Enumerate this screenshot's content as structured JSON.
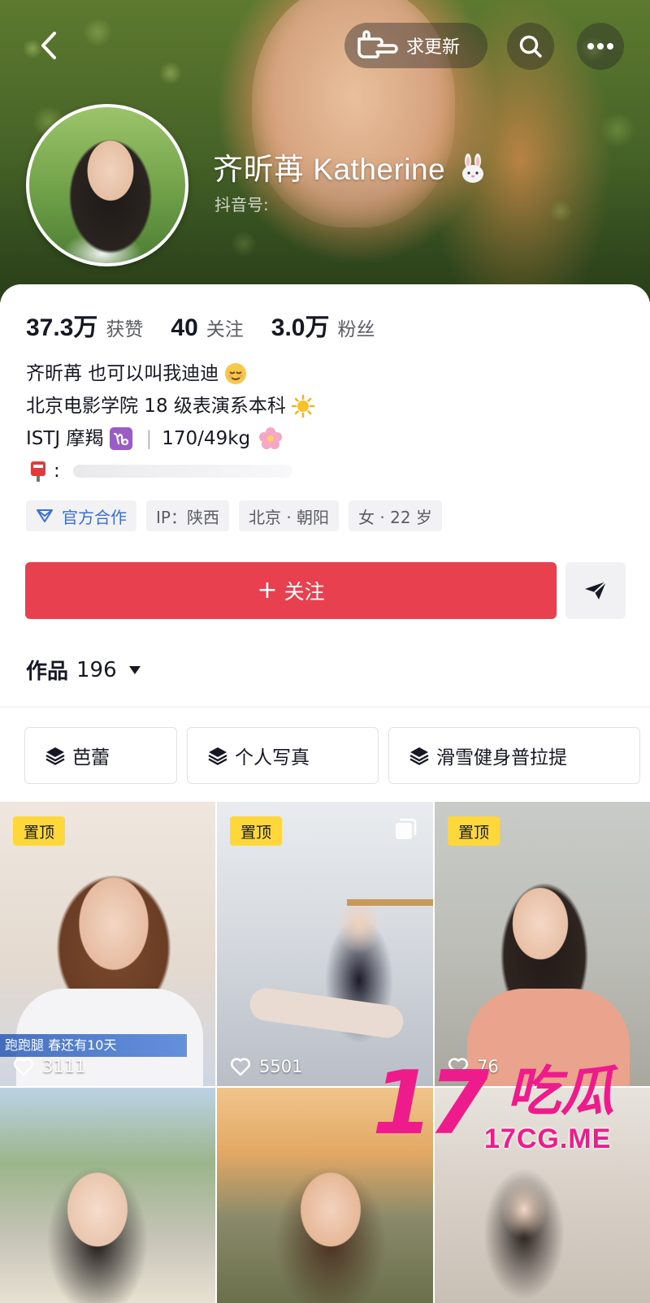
{
  "header": {
    "ask_update_label": "求更新",
    "name": "齐昕苒 Katherine",
    "douyin_id_label": "抖音号:"
  },
  "stats": [
    {
      "value": "37.3万",
      "label": "获赞"
    },
    {
      "value": "40",
      "label": "关注"
    },
    {
      "value": "3.0万",
      "label": "粉丝"
    }
  ],
  "bio": {
    "line1": "齐昕苒 也可以叫我迪迪",
    "line2": "北京电影学院 18 级表演系本科",
    "line3_mbti": "ISTJ 摩羯",
    "line3_sep": "|",
    "line3_body": "170/49kg",
    "line4_prefix": ":"
  },
  "tags": [
    {
      "label": "官方合作"
    },
    {
      "label": "IP：陕西"
    },
    {
      "label": "北京 · 朝阳"
    },
    {
      "label": "女 · 22 岁"
    }
  ],
  "follow_button": {
    "plus": "+",
    "label": "关注"
  },
  "works": {
    "label": "作品",
    "count": "196"
  },
  "collections": [
    {
      "label": "芭蕾"
    },
    {
      "label": "个人写真"
    },
    {
      "label": "滑雪健身普拉提"
    }
  ],
  "videos": [
    {
      "pinned": true,
      "pin_label": "置顶",
      "likes": "3111",
      "overlay_text": "跑跑腿 春还有10天"
    },
    {
      "pinned": true,
      "pin_label": "置顶",
      "likes": "5501"
    },
    {
      "pinned": true,
      "pin_label": "置顶",
      "likes": "76"
    },
    {
      "pinned": false,
      "likes": ""
    },
    {
      "pinned": false,
      "likes": ""
    },
    {
      "pinned": false,
      "likes": ""
    }
  ],
  "watermark": {
    "big": "17",
    "cn": "吃瓜",
    "url": "17CG.ME"
  },
  "colors": {
    "accent": "#e9404f",
    "pin": "#fed83a",
    "official_blue": "#3b6fd6",
    "watermark": "#ee1b8c"
  },
  "icons": [
    "back-arrow-icon",
    "pointing-hand-icon",
    "search-icon",
    "more-icon",
    "rabbit-emoji-icon",
    "relieved-face-emoji-icon",
    "sun-emoji-icon",
    "capricorn-icon",
    "flower-emoji-icon",
    "mailbox-icon",
    "official-cooperation-icon",
    "share-arrow-icon",
    "caret-down-icon",
    "collection-stack-icon",
    "heart-icon",
    "album-icon"
  ]
}
